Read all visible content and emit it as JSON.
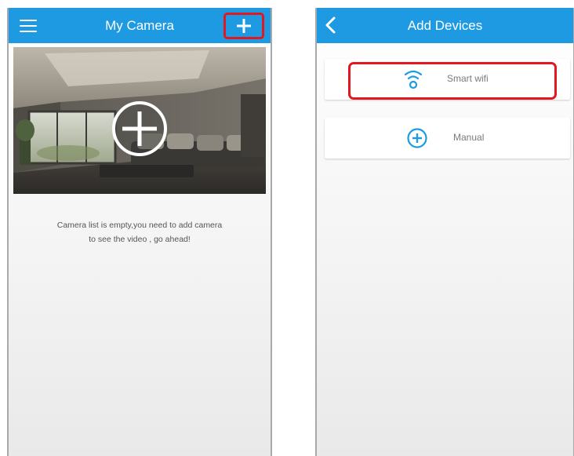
{
  "left_screen": {
    "title": "My Camera",
    "menu_icon": "hamburger-menu-icon",
    "add_icon": "plus-icon",
    "hero_icon": "plus-circle-icon",
    "empty_message_line1": "Camera list is empty,you need to add camera",
    "empty_message_line2": "to see the video , go ahead!"
  },
  "right_screen": {
    "title": "Add Devices",
    "back_icon": "chevron-left-icon",
    "options": [
      {
        "label": "Smart wifi",
        "icon": "wifi-signal-icon"
      },
      {
        "label": "Manual",
        "icon": "plus-circle-icon"
      }
    ]
  },
  "colors": {
    "header": "#1e9ae3",
    "highlight": "#e3171e"
  }
}
